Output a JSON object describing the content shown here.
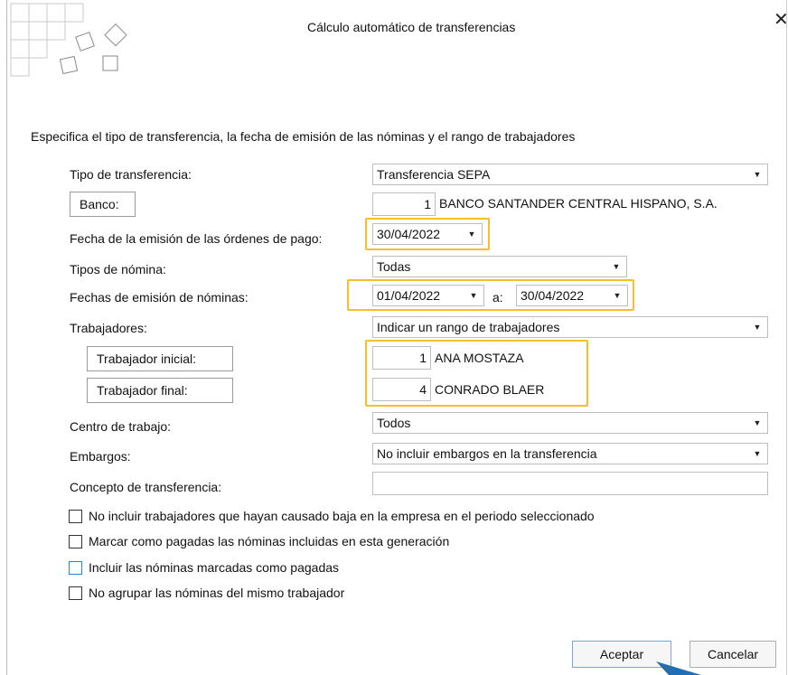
{
  "window": {
    "title": "Cálculo automático de transferencias"
  },
  "instructions": "Especifica el tipo de transferencia, la fecha de emisión de las nóminas y el rango de trabajadores",
  "form": {
    "tipo_transferencia": {
      "label": "Tipo de transferencia:",
      "value": "Transferencia SEPA"
    },
    "banco": {
      "label": "Banco:",
      "code": "1",
      "name": "BANCO SANTANDER CENTRAL HISPANO, S.A."
    },
    "fecha_emision_ordenes": {
      "label": "Fecha de la emisión de las órdenes de pago:",
      "value": "30/04/2022"
    },
    "tipos_nomina": {
      "label": "Tipos de nómina:",
      "value": "Todas"
    },
    "fechas_emision_nominas": {
      "label": "Fechas de emisión de nóminas:",
      "from": "01/04/2022",
      "separator": "a:",
      "to": "30/04/2022"
    },
    "trabajadores": {
      "label": "Trabajadores:",
      "value": "Indicar un rango de trabajadores"
    },
    "trabajador_inicial": {
      "label": "Trabajador inicial:",
      "code": "1",
      "name": "ANA MOSTAZA"
    },
    "trabajador_final": {
      "label": "Trabajador final:",
      "code": "4",
      "name": "CONRADO BLAER"
    },
    "centro_trabajo": {
      "label": "Centro de trabajo:",
      "value": "Todos"
    },
    "embargos": {
      "label": "Embargos:",
      "value": "No incluir embargos en la transferencia"
    },
    "concepto": {
      "label": "Concepto de transferencia:",
      "value": ""
    }
  },
  "options": [
    {
      "label": "No incluir trabajadores que hayan causado baja en la empresa en el periodo seleccionado",
      "checked": false
    },
    {
      "label": "Marcar como pagadas las nóminas incluidas en esta generación",
      "checked": false
    },
    {
      "label": "Incluir las nóminas marcadas como pagadas",
      "checked": false
    },
    {
      "label": "No agrupar las nóminas del mismo trabajador",
      "checked": false
    }
  ],
  "buttons": {
    "accept": "Aceptar",
    "cancel": "Cancelar"
  },
  "colors": {
    "highlight": "#f4bf2a",
    "arrow": "#1e6fb5",
    "focus_checkbox": "#1e88d8"
  }
}
